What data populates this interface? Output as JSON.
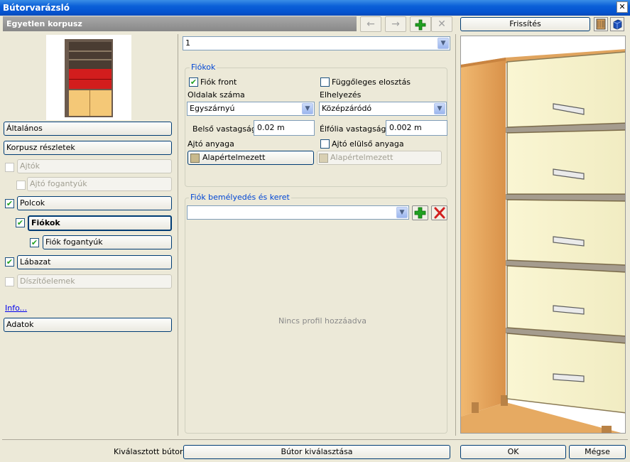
{
  "window": {
    "title": "Bútorvarázsló",
    "close_symbol": "✕"
  },
  "header": {
    "title": "Egyetlen korpusz"
  },
  "toolbar": {
    "refresh_label": "Frissítés",
    "icons": [
      "arrow-left-icon",
      "arrow-right-icon",
      "add-icon",
      "delete-icon"
    ]
  },
  "selector": {
    "value": "1"
  },
  "sidebar": {
    "items": [
      {
        "label": "Általános",
        "checkbox": null,
        "enabled": true,
        "selected": false
      },
      {
        "label": "Korpusz részletek",
        "checkbox": null,
        "enabled": true,
        "selected": false
      },
      {
        "label": "Ajtók",
        "checkbox": false,
        "enabled": false,
        "selected": false
      },
      {
        "label": "Ajtó fogantyúk",
        "checkbox": false,
        "enabled": false,
        "selected": false
      },
      {
        "label": "Polcok",
        "checkbox": true,
        "enabled": true,
        "selected": false
      },
      {
        "label": "Fiókok",
        "checkbox": true,
        "enabled": true,
        "selected": true
      },
      {
        "label": "Fiók fogantyúk",
        "checkbox": true,
        "enabled": true,
        "selected": false
      },
      {
        "label": "Lábazat",
        "checkbox": true,
        "enabled": true,
        "selected": false
      },
      {
        "label": "Díszítőelemek",
        "checkbox": false,
        "enabled": false,
        "selected": false
      }
    ],
    "info_link": "Info...",
    "data_button": "Adatok"
  },
  "drawers": {
    "group_title": "Fiókok",
    "drawer_front_label": "Fiók front",
    "drawer_front_checked": true,
    "vertical_distribution_label": "Függőleges elosztás",
    "vertical_distribution_checked": false,
    "sides_count_label": "Oldalak száma",
    "sides_count_value": "Egyszárnyú",
    "placement_label": "Elhelyezés",
    "placement_value": "Középzáródó",
    "inner_thickness_label": "Belső vastagság",
    "inner_thickness_value": "0.02 m",
    "edge_foil_label": "Élfólia vastagsága",
    "edge_foil_value": "0.002 m",
    "door_material_label": "Ajtó anyaga",
    "door_material_button": "Alapértelmezett",
    "door_front_material_label": "Ajtó elülső anyaga",
    "door_front_material_checked": false,
    "door_front_material_button": "Alapértelmezett"
  },
  "profile": {
    "group_title": "Fiók bemélyedés és keret",
    "combo_value": "",
    "empty_text": "Nincs profil hozzáadva"
  },
  "footer": {
    "selected_label": "Kiválasztott bútor:",
    "select_button": "Bútor kiválasztása",
    "ok_button": "OK",
    "cancel_button": "Mégse"
  },
  "colors": {
    "title_bar": "#0553cf",
    "accent_green": "#21a121",
    "delete_red": "#d21f1f",
    "cabinet_wood": "#e8a760",
    "drawer_front": "#f7f3cc"
  }
}
